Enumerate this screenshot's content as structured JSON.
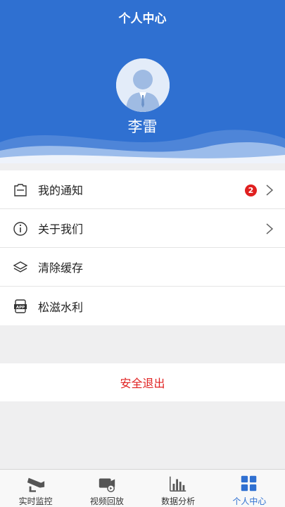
{
  "header": {
    "title": "个人中心",
    "username": "李雷"
  },
  "menu": [
    {
      "label": "我的通知",
      "icon": "inbox-icon",
      "badge": "2",
      "chevron": true
    },
    {
      "label": "关于我们",
      "icon": "info-icon",
      "chevron": true
    },
    {
      "label": "清除缓存",
      "icon": "layers-icon"
    },
    {
      "label": "松滋水利",
      "icon": "app-icon"
    }
  ],
  "logout": {
    "label": "安全退出"
  },
  "tabbar": [
    {
      "label": "实时监控",
      "icon": "camera-icon"
    },
    {
      "label": "视频回放",
      "icon": "video-replay-icon"
    },
    {
      "label": "数据分析",
      "icon": "bar-chart-icon"
    },
    {
      "label": "个人中心",
      "icon": "grid-icon",
      "active": true
    }
  ],
  "colors": {
    "primary": "#2f70d1",
    "badge": "#e02020",
    "logout": "#e02020"
  }
}
